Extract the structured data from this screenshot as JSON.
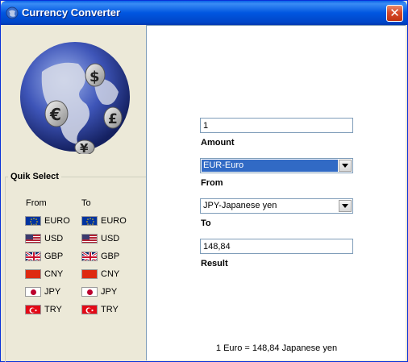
{
  "window": {
    "title": "Currency Converter",
    "close_label": "✕"
  },
  "quick_select": {
    "title": "Quik Select",
    "from_header": "From",
    "to_header": "To",
    "currencies": [
      {
        "code": "EURO",
        "flag": "eu-flag-icon"
      },
      {
        "code": "USD",
        "flag": "us-flag-icon"
      },
      {
        "code": "GBP",
        "flag": "uk-flag-icon"
      },
      {
        "code": "CNY",
        "flag": "cn-flag-icon"
      },
      {
        "code": "JPY",
        "flag": "jp-flag-icon"
      },
      {
        "code": "TRY",
        "flag": "tr-flag-icon"
      }
    ]
  },
  "converter": {
    "amount_value": "1",
    "amount_label": "Amount",
    "from_selected": "EUR-Euro",
    "from_label": "From",
    "to_selected": "JPY-Japanese yen",
    "to_label": "To",
    "result_value": "148,84",
    "result_label": "Result",
    "summary": "1 Euro = 148,84 Japanese yen"
  },
  "colors": {
    "titlebar": "#0054e3",
    "selection": "#316ac5",
    "panel": "#ece9d8"
  }
}
